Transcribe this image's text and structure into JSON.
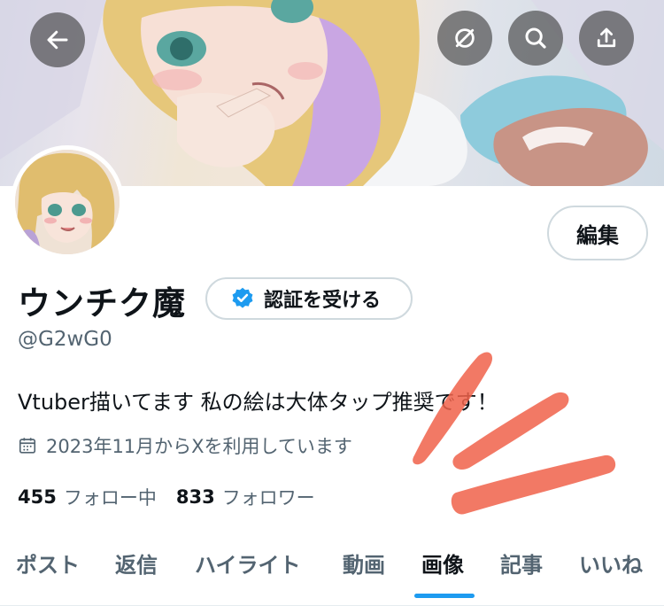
{
  "header": {
    "back_icon": "arrow-left-icon",
    "buttons": [
      "no-signal-icon",
      "search-icon",
      "share-icon"
    ]
  },
  "profile": {
    "display_name": "ウンチク魔",
    "verify_label": "認証を受ける",
    "handle": "@G2wG0",
    "bio": "Vtuber描いてます 私の絵は大体タップ推奨です！",
    "joined": "2023年11月からXを利用しています",
    "edit_label": "編集",
    "following_count": "455",
    "following_label": "フォロー中",
    "followers_count": "833",
    "followers_label": "フォロワー"
  },
  "tabs": [
    {
      "label": "ポスト"
    },
    {
      "label": "返信"
    },
    {
      "label": "ハイライト"
    },
    {
      "label": "動画"
    },
    {
      "label": "画像"
    },
    {
      "label": "記事"
    },
    {
      "label": "いいね"
    }
  ],
  "active_tab": "画像",
  "colors": {
    "accent": "#1d9bf0",
    "text_primary": "#0f1419",
    "text_secondary": "#536471",
    "scribble": "#f0614a"
  }
}
